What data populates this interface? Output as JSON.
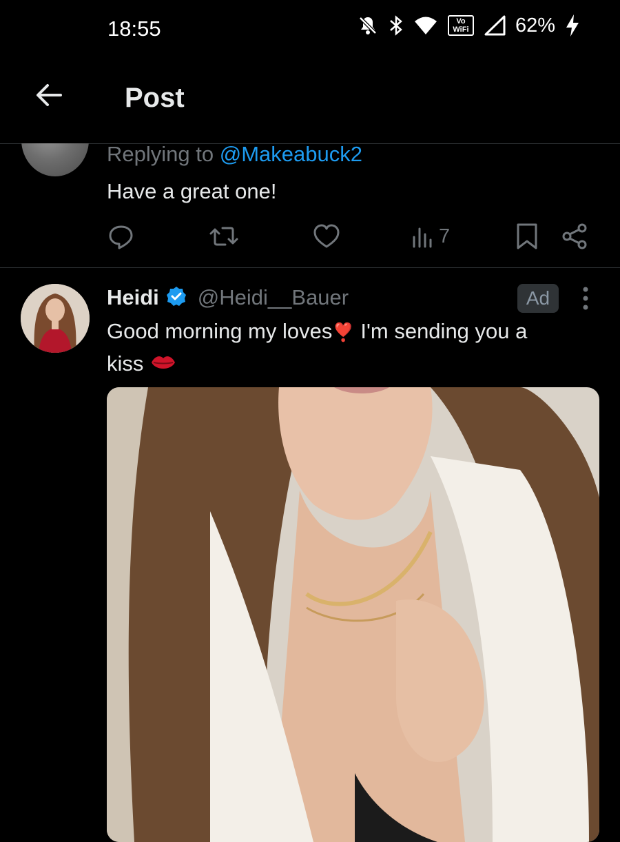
{
  "status_bar": {
    "time": "18:55",
    "volte_label": "Vo¹\nWiFi",
    "battery": "62%",
    "icons": [
      "notifications-off-icon",
      "bluetooth-icon",
      "wifi-icon",
      "volte-wifi-icon",
      "signal-icon",
      "charging-icon"
    ]
  },
  "header": {
    "title": "Post",
    "back_icon": "arrow-left-icon"
  },
  "reply_post": {
    "replying_prefix": "Replying to ",
    "replying_to": "@Makeabuck2",
    "text": "Have a great one!",
    "views": "7",
    "icons": [
      "reply-icon",
      "repost-icon",
      "like-icon",
      "views-icon",
      "bookmark-icon",
      "share-icon"
    ]
  },
  "ad_post": {
    "name": "Heidi",
    "verified": true,
    "handle": "@Heidi__Bauer",
    "ad_label": "Ad",
    "text_line1": "Good morning my loves",
    "text_line1b": " I'm sending you a",
    "text_line2": "kiss",
    "emoji_heart": "❣️",
    "emoji_kiss": "💋"
  },
  "colors": {
    "background": "#000000",
    "text": "#e7e9ea",
    "muted": "#71767b",
    "accent": "#1d9bf0",
    "divider": "#2f3336"
  }
}
